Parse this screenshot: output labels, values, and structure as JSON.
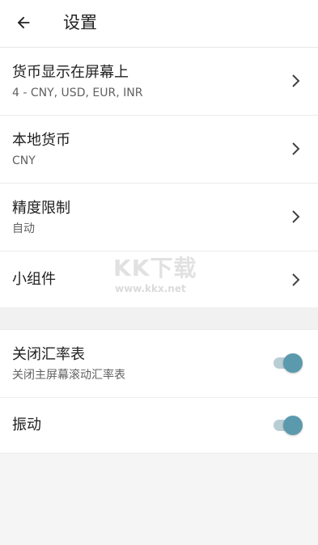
{
  "header": {
    "title": "设置",
    "back_icon": "arrow-left-icon"
  },
  "settings": {
    "currencies_on_screen": {
      "title": "货币显示在屏幕上",
      "subtitle": "4 - CNY, USD, EUR, INR"
    },
    "local_currency": {
      "title": "本地货币",
      "subtitle": "CNY"
    },
    "precision_limit": {
      "title": "精度限制",
      "subtitle": "自动"
    },
    "widget": {
      "title": "小组件"
    },
    "close_rate_table": {
      "title": "关闭汇率表",
      "subtitle": "关闭主屏幕滚动汇率表",
      "enabled": true
    },
    "vibration": {
      "title": "振动",
      "enabled": true
    }
  },
  "watermark": {
    "brand": "KK下载",
    "url": "www.kkx.net"
  },
  "colors": {
    "toggle_knob": "#5b9aad",
    "toggle_track": "#b9cdd4",
    "background": "#f5f5f5"
  }
}
